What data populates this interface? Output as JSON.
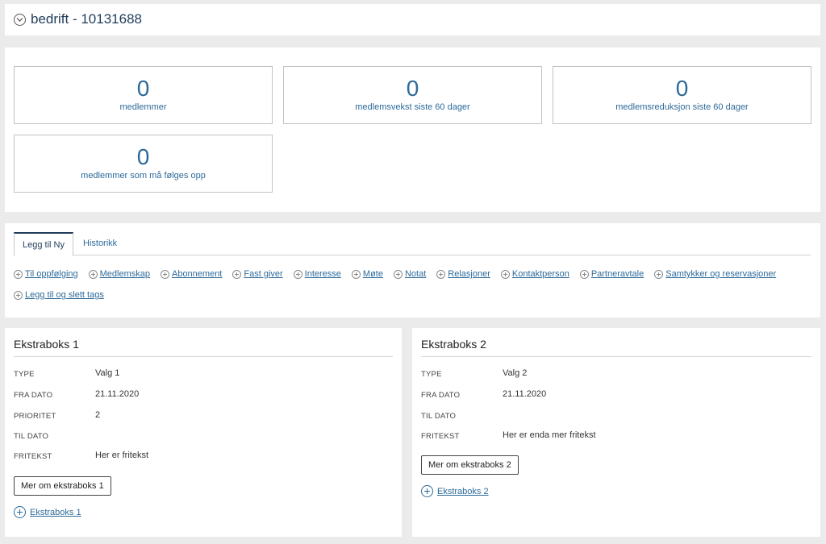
{
  "header": {
    "title": "bedrift - 10131688",
    "toggle_icon": "chevron-down-circle-icon"
  },
  "stats": [
    {
      "value": "0",
      "label": "medlemmer"
    },
    {
      "value": "0",
      "label": "medlemsvekst siste 60 dager"
    },
    {
      "value": "0",
      "label": "medlemsreduksjon siste 60 dager"
    },
    {
      "value": "0",
      "label": "medlemmer som må følges opp"
    }
  ],
  "tabs": [
    {
      "label": "Legg til Ny",
      "active": true
    },
    {
      "label": "Historikk",
      "active": false
    }
  ],
  "actions": [
    "Til oppfølging",
    "Medlemskap",
    "Abonnement",
    "Fast giver",
    "Interesse",
    "Møte",
    "Notat",
    "Relasjoner",
    "Kontaktperson",
    "Partneravtale",
    "Samtykker og reservasjoner",
    "Legg til og slett tags"
  ],
  "box1": {
    "title": "Ekstraboks 1",
    "fields": [
      {
        "label": "TYPE",
        "value": "Valg 1"
      },
      {
        "label": "FRA DATO",
        "value": "21.11.2020"
      },
      {
        "label": "PRIORITET",
        "value": "2"
      },
      {
        "label": "TIL DATO",
        "value": ""
      },
      {
        "label": "FRITEKST",
        "value": "Her er fritekst"
      }
    ],
    "button": "Mer om ekstraboks 1",
    "add_link": "Ekstraboks 1"
  },
  "box2": {
    "title": "Ekstraboks 2",
    "fields": [
      {
        "label": "TYPE",
        "value": "Valg 2"
      },
      {
        "label": "FRA DATO",
        "value": "21.11.2020"
      },
      {
        "label": "TIL DATO",
        "value": ""
      },
      {
        "label": "FRITEKST",
        "value": "Her er enda mer fritekst"
      }
    ],
    "button": "Mer om ekstraboks 2",
    "add_link": "Ekstraboks 2"
  },
  "colors": {
    "accent": "#2d6a9a",
    "title": "#1f3c5a",
    "background": "#ebebeb"
  }
}
